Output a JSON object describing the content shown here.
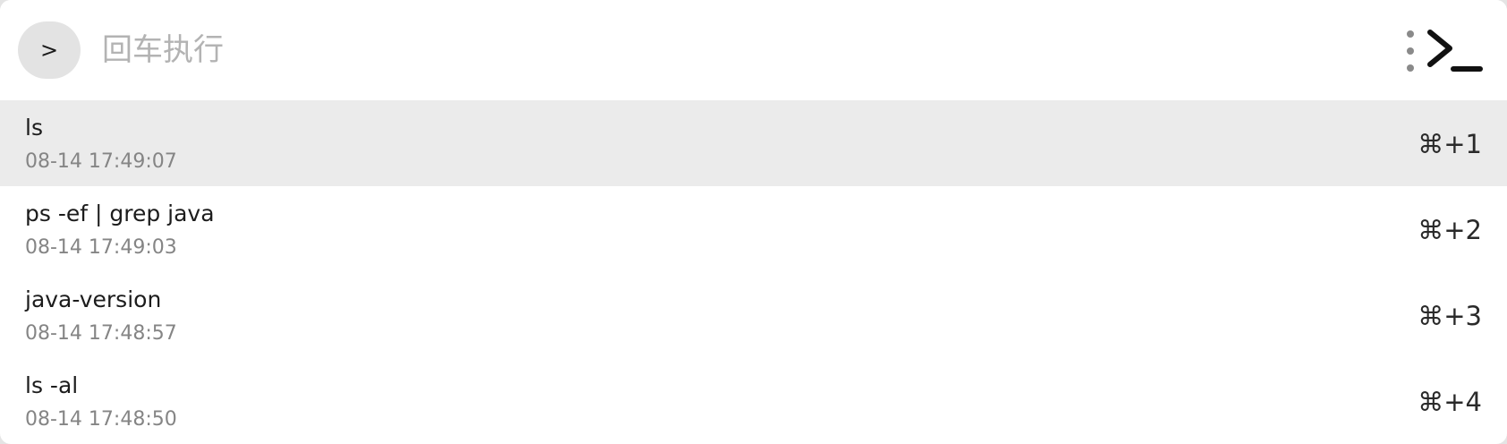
{
  "header": {
    "prompt_symbol": ">",
    "input_placeholder": "回车执行",
    "input_value": "",
    "more_icon": "vertical-ellipsis",
    "terminal_icon": "terminal-prompt"
  },
  "history": [
    {
      "command": "ls",
      "time": "08-14 17:49:07",
      "shortcut": "⌘+1",
      "selected": true
    },
    {
      "command": "ps -ef | grep java",
      "time": "08-14 17:49:03",
      "shortcut": "⌘+2",
      "selected": false
    },
    {
      "command": "java-version",
      "time": "08-14 17:48:57",
      "shortcut": "⌘+3",
      "selected": false
    },
    {
      "command": "ls -al",
      "time": "08-14 17:48:50",
      "shortcut": "⌘+4",
      "selected": false
    }
  ],
  "colors": {
    "background": "#ffffff",
    "selected_row": "#ebebeb",
    "badge": "#e3e3e3",
    "placeholder": "#b3b3b3",
    "secondary_text": "#858585"
  }
}
